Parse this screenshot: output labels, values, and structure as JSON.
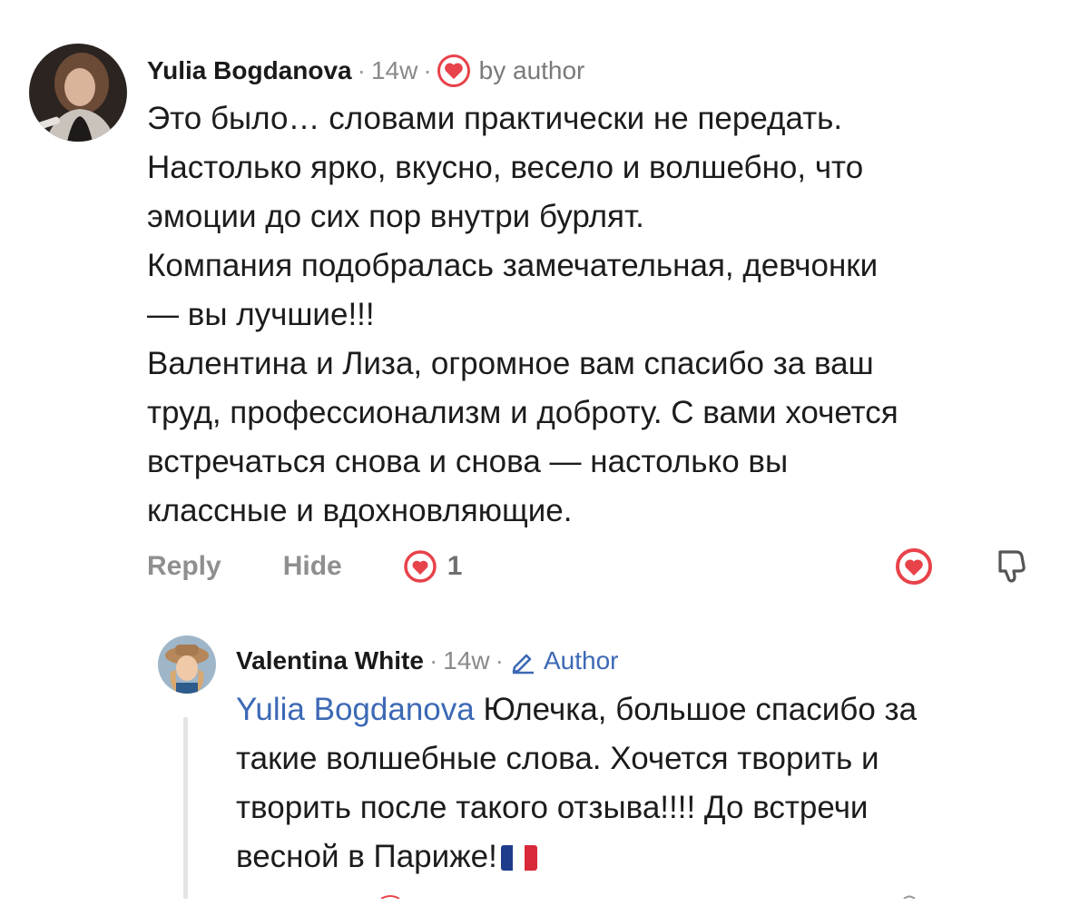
{
  "comment": {
    "author": "Yulia Bogdanova",
    "separator": "·",
    "time": "14w",
    "liked_by": "by author",
    "body": [
      "Это было… словами практически не передать.",
      "Настолько ярко, вкусно, весело и волшебно, что",
      "эмоции до сих пор внутри бурлят.",
      "Компания подобралась замечательная, девчонки",
      "— вы лучшие!!!",
      "Валентина и Лиза, огромное вам спасибо за ваш",
      "труд, профессионализм и доброту. С вами хочется",
      "встречаться снова и снова — настолько вы",
      "классные и вдохновляющие."
    ],
    "actions": {
      "reply": "Reply",
      "hide": "Hide",
      "like_count": "1"
    },
    "icons": {
      "liked_badge": "heart-filled-icon",
      "like": "heart-icon",
      "react": "heart-button-icon",
      "dislike": "thumbs-down-icon"
    },
    "accent_color": "#e8424a"
  },
  "reply": {
    "author": "Valentina White",
    "separator": "·",
    "time": "14w",
    "author_label": "Author",
    "mention": "Yulia Bogdanova",
    "body_first": " Юлечка, большое спасибо за",
    "body": [
      "такие волшебные слова. Хочется творить и",
      "творить после такого отзыва!!!! До встречи",
      "весной в Париже!"
    ],
    "flag": "france-flag-icon",
    "link_color": "#3c69b5"
  }
}
